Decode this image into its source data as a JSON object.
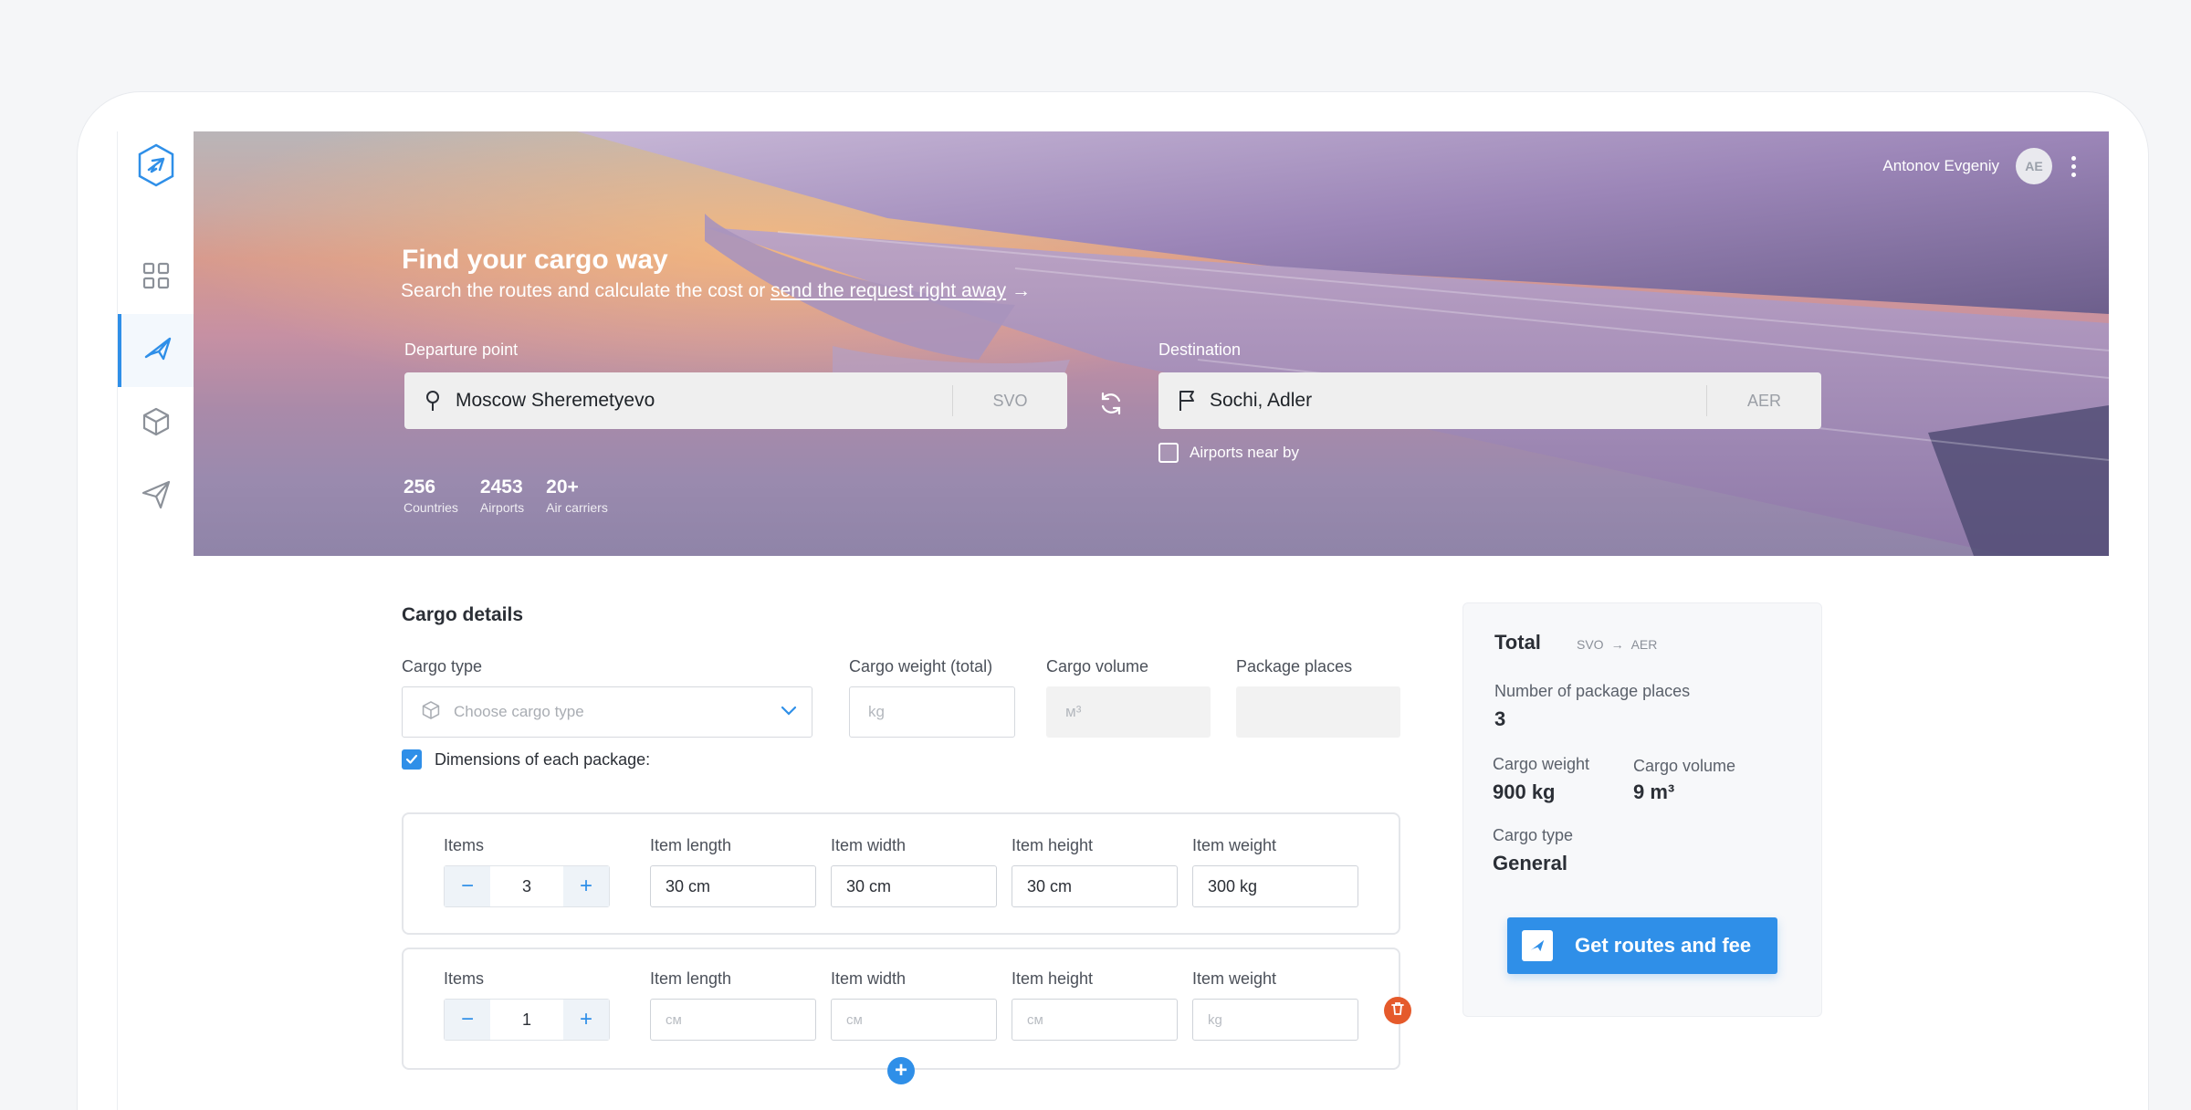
{
  "header": {
    "user_name": "Antonov Evgeniy",
    "user_initials": "AE"
  },
  "hero": {
    "title": "Find your cargo way",
    "subtitle": "Search the routes and calculate the cost or",
    "subtitle_link": "send the request right away",
    "departure_label": "Departure point",
    "departure_value": "Moscow Sheremetyevo",
    "departure_code": "SVO",
    "destination_label": "Destination",
    "destination_value": "Sochi, Adler",
    "destination_code": "AER",
    "airports_near_label": "Airports near by",
    "airports_near_checked": false,
    "stats": [
      {
        "value": "256",
        "label": "Countries"
      },
      {
        "value": "2453",
        "label": "Airports"
      },
      {
        "value": "20+",
        "label": "Air carriers"
      }
    ]
  },
  "cargo": {
    "section_title": "Cargo details",
    "type_label": "Cargo type",
    "type_placeholder": "Choose cargo type",
    "weight_label": "Cargo weight (total)",
    "weight_placeholder": "kg",
    "volume_label": "Cargo volume",
    "volume_placeholder": "м³",
    "places_label": "Package places",
    "dimensions_label": "Dimensions of each package:",
    "dimensions_checked": true,
    "col_labels": {
      "items": "Items",
      "length": "Item length",
      "width": "Item width",
      "height": "Item height",
      "weight": "Item weight"
    },
    "packages": [
      {
        "items": "3",
        "length": "30 cm",
        "width": "30 cm",
        "height": "30 cm",
        "weight": "300 kg"
      },
      {
        "items": "1",
        "length_placeholder": "см",
        "width_placeholder": "см",
        "height_placeholder": "см",
        "weight_placeholder": "kg"
      }
    ],
    "minus": "−",
    "plus": "+"
  },
  "total": {
    "title": "Total",
    "from": "SVO",
    "to": "AER",
    "places_label": "Number of package places",
    "places_value": "3",
    "weight_label": "Cargo weight",
    "weight_value": "900 kg",
    "volume_label": "Cargo volume",
    "volume_value": "9 m³",
    "type_label": "Cargo type",
    "type_value": "General",
    "cta": "Get routes and fee"
  },
  "colors": {
    "accent": "#2f8fe8",
    "danger": "#e55a2b"
  },
  "icons": {
    "nav": [
      "dashboard-icon",
      "plane-icon",
      "box-icon",
      "send-icon"
    ]
  }
}
